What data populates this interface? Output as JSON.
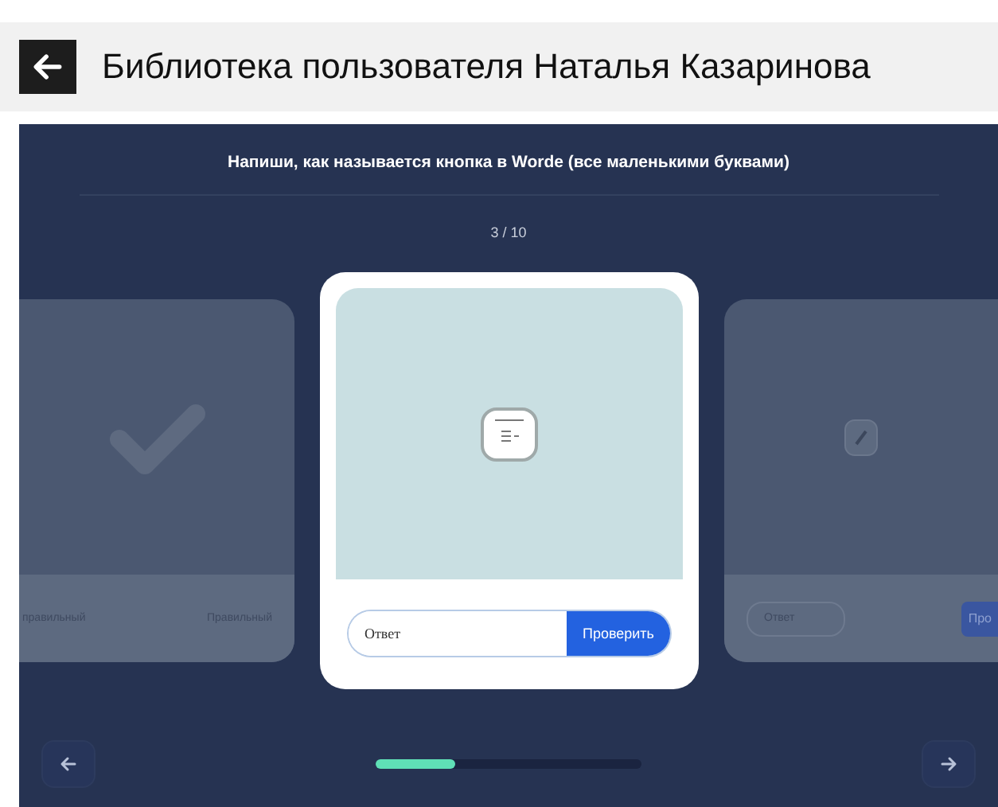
{
  "header": {
    "title": "Библиотека пользователя Наталья Казаринова"
  },
  "question": "Напиши, как называется кнопка в Worde (все маленькими буквами)",
  "counter": "3 / 10",
  "cards": [
    {
      "kind": "answered",
      "labels": [
        "правильный",
        "Правильный"
      ]
    },
    {
      "kind": "current",
      "placeholder": "Ответ",
      "button": "Проверить"
    },
    {
      "kind": "upcoming",
      "placeholder": "Ответ",
      "button": "Про"
    }
  ],
  "progress": {
    "level": 0.3
  }
}
